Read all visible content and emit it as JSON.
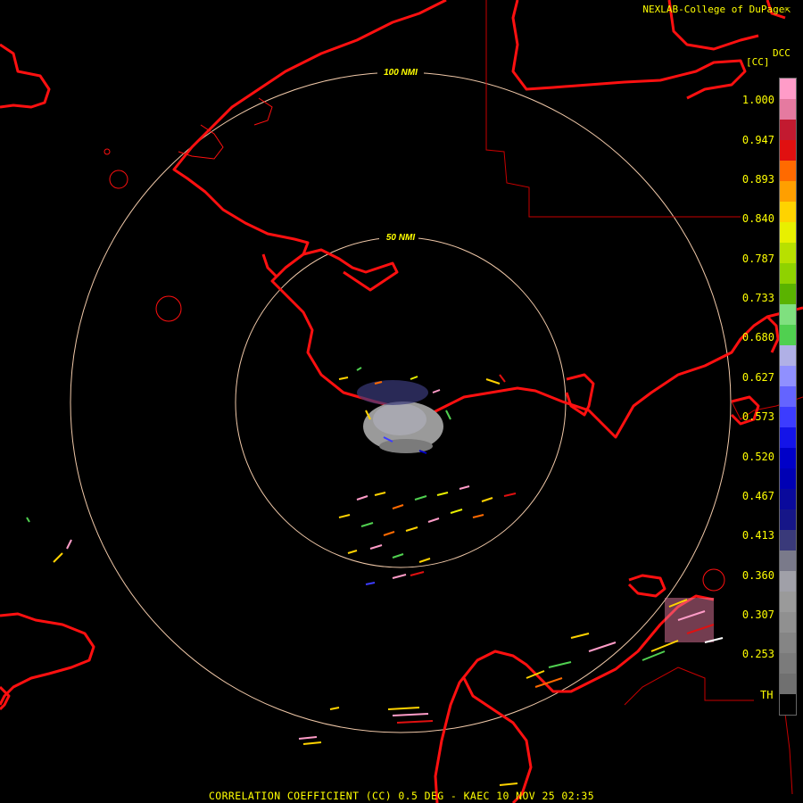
{
  "header": {
    "credit": "NEXLAB-College of DuPage",
    "credit_mark": "⇱"
  },
  "legend": {
    "product_code": "DCC",
    "unit": "[CC]",
    "ticks": [
      "1.000",
      "0.947",
      "0.893",
      "0.840",
      "0.787",
      "0.733",
      "0.680",
      "0.627",
      "0.573",
      "0.520",
      "0.467",
      "0.413",
      "0.360",
      "0.307",
      "0.253"
    ],
    "threshold_label": "TH",
    "colors": [
      "#ff9cc8",
      "#e57aa0",
      "#c21a30",
      "#e01010",
      "#ff6a00",
      "#ff9f00",
      "#ffd300",
      "#e8f000",
      "#b8e000",
      "#8fd200",
      "#5ab300",
      "#7fe07f",
      "#50d050",
      "#b0b0e6",
      "#9090ff",
      "#6464ff",
      "#3c3cff",
      "#1414e8",
      "#0000c8",
      "#0000b4",
      "#0a0a9c",
      "#161688",
      "#3a3a7a",
      "#7a7a8a",
      "#a0a0a8",
      "#9a9a9a",
      "#909090",
      "#858585",
      "#7b7b7b",
      "#707070",
      "#000000"
    ]
  },
  "map": {
    "range_rings": [
      {
        "label": "50 NMI"
      },
      {
        "label": "100 NMI"
      }
    ]
  },
  "footer": {
    "caption": "CORRELATION COEFFICIENT (CC) 0.5 DEG - KAEC 10 NOV 25 02:35"
  },
  "style": {
    "text_yellow": "#ffff00",
    "coast_red": "#ff1010",
    "ring_color": "#f0c8a8",
    "border_red": "#c80000"
  }
}
